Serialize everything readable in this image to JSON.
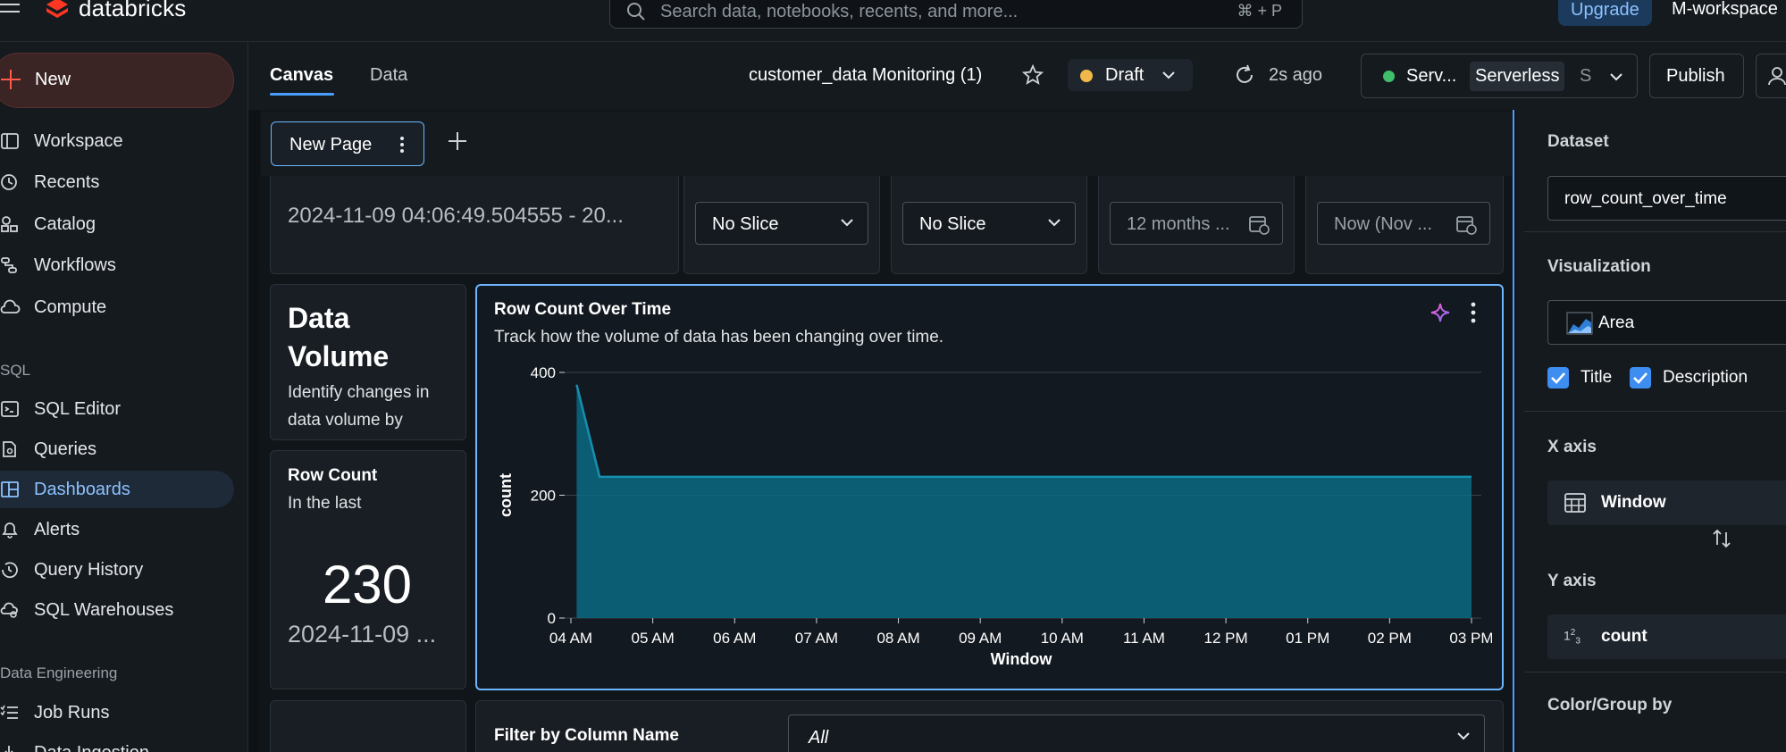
{
  "topbar": {
    "logo_text": "databricks",
    "search_placeholder": "Search data, notebooks, recents, and more...",
    "search_shortcut": "⌘ + P",
    "upgrade_label": "Upgrade",
    "workspace_name": "M-workspace"
  },
  "sidebar": {
    "new_label": "New",
    "items": [
      {
        "label": "Workspace",
        "icon": "workspace-icon"
      },
      {
        "label": "Recents",
        "icon": "clock-icon"
      },
      {
        "label": "Catalog",
        "icon": "catalog-icon"
      },
      {
        "label": "Workflows",
        "icon": "workflows-icon"
      },
      {
        "label": "Compute",
        "icon": "cloud-icon"
      }
    ],
    "sql_section": "SQL",
    "sql_items": [
      {
        "label": "SQL Editor",
        "icon": "sql-editor-icon"
      },
      {
        "label": "Queries",
        "icon": "queries-icon"
      },
      {
        "label": "Dashboards",
        "icon": "dashboards-icon"
      },
      {
        "label": "Alerts",
        "icon": "bell-icon"
      },
      {
        "label": "Query History",
        "icon": "history-icon"
      },
      {
        "label": "SQL Warehouses",
        "icon": "warehouse-icon"
      }
    ],
    "de_section": "Data Engineering",
    "de_items": [
      {
        "label": "Job Runs",
        "icon": "job-runs-icon"
      },
      {
        "label": "Data Ingestion",
        "icon": "ingestion-icon"
      }
    ]
  },
  "header": {
    "tabs": [
      "Canvas",
      "Data"
    ],
    "dashboard_title": "customer_data Monitoring (1)",
    "status": "Draft",
    "refreshed": "2s ago",
    "compute": {
      "short": "Serv...",
      "badge": "Serverless",
      "suffix": "S"
    },
    "publish_label": "Publish"
  },
  "pages": {
    "active": "New Page"
  },
  "filters": {
    "range": "2024-11-09 04:06:49.504555 - 20...",
    "slice1": "No Slice",
    "slice2": "No Slice",
    "from": "12 months ...",
    "to": "Now (Nov ..."
  },
  "text_widget": {
    "title": "Data Volume",
    "description": "Identify changes in data volume by"
  },
  "counter": {
    "title": "Row Count",
    "subtitle": "In the last",
    "value": "230",
    "date": "2024-11-09 ..."
  },
  "chart": {
    "title": "Row Count Over Time",
    "description": "Track how the volume of data has been changing over time."
  },
  "chart_data": {
    "type": "area",
    "xlabel": "Window",
    "ylabel": "count",
    "ylim": [
      0,
      400
    ],
    "yticks": [
      0,
      200,
      400
    ],
    "xticks": [
      "04 AM",
      "05 AM",
      "06 AM",
      "07 AM",
      "08 AM",
      "09 AM",
      "10 AM",
      "11 AM",
      "12 PM",
      "01 PM",
      "02 PM",
      "03 PM"
    ],
    "points": [
      {
        "x": 4.07,
        "y": 380
      },
      {
        "x": 4.35,
        "y": 230
      },
      {
        "x": 15.0,
        "y": 230
      }
    ],
    "grid": "horizontal",
    "color": "#0b6a82",
    "line_color": "#168fb0"
  },
  "filter_widget": {
    "title": "Filter by Column Name",
    "value": "All"
  },
  "panel": {
    "dataset_label": "Dataset",
    "dataset_value": "row_count_over_time",
    "viz_label": "Visualization",
    "viz_value": "Area",
    "title_cb": "Title",
    "desc_cb": "Description",
    "xaxis_label": "X axis",
    "xaxis_field": "Window",
    "yaxis_label": "Y axis",
    "yaxis_field": "count",
    "color_label": "Color/Group by"
  }
}
